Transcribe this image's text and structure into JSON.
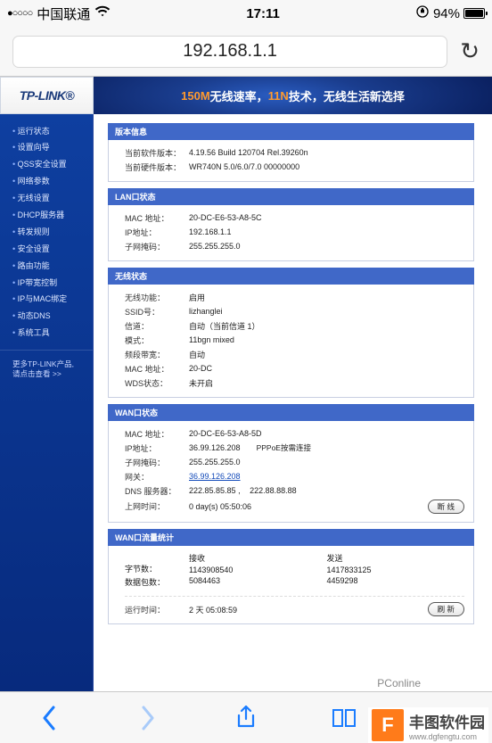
{
  "status": {
    "signal": "●○○○○",
    "carrier": "中国联通",
    "time": "17:11",
    "lock": "⟳",
    "battery": "94%"
  },
  "addr": "192.168.1.1",
  "logo": "TP-LINK",
  "banner": {
    "t1": "150M",
    "t2": "无线速率，",
    "t3": "11N",
    "t4": "技术，无线生活新选择"
  },
  "nav": [
    "运行状态",
    "设置向导",
    "QSS安全设置",
    "网络参数",
    "无线设置",
    "DHCP服务器",
    "转发规则",
    "安全设置",
    "路由功能",
    "IP带宽控制",
    "IP与MAC绑定",
    "动态DNS",
    "系统工具"
  ],
  "nav_more1": "更多TP-LINK产品,",
  "nav_more2": "请点击查看 >>",
  "sec_version": {
    "title": "版本信息",
    "rows": [
      {
        "lbl": "当前软件版本：",
        "val": "4.19.56 Build 120704 Rel.39260n"
      },
      {
        "lbl": "当前硬件版本：",
        "val": "WR740N 5.0/6.0/7.0 00000000"
      }
    ]
  },
  "sec_lan": {
    "title": "LAN口状态",
    "rows": [
      {
        "lbl": "MAC 地址：",
        "val": "20-DC-E6-53-A8-5C"
      },
      {
        "lbl": "IP地址：",
        "val": "192.168.1.1"
      },
      {
        "lbl": "子网掩码：",
        "val": "255.255.255.0"
      }
    ]
  },
  "sec_wlan": {
    "title": "无线状态",
    "rows": [
      {
        "lbl": "无线功能：",
        "val": "启用"
      },
      {
        "lbl": "SSID号：",
        "val": "lizhanglei"
      },
      {
        "lbl": "信道：",
        "val": "自动（当前信道 1）"
      },
      {
        "lbl": "模式：",
        "val": "11bgn mixed"
      },
      {
        "lbl": "频段带宽：",
        "val": "自动"
      },
      {
        "lbl": "MAC 地址：",
        "val": "20-DC"
      },
      {
        "lbl": "WDS状态：",
        "val": "未开启"
      }
    ]
  },
  "sec_wan": {
    "title": "WAN口状态",
    "mac": {
      "lbl": "MAC 地址：",
      "val": "20-DC-E6-53-A8-5D"
    },
    "ip": {
      "lbl": "IP地址：",
      "val": "36.99.126.208",
      "extra": "PPPoE按需连接"
    },
    "mask": {
      "lbl": "子网掩码：",
      "val": "255.255.255.0"
    },
    "gw": {
      "lbl": "网关：",
      "val": "36.99.126.208"
    },
    "dns": {
      "lbl": "DNS 服务器：",
      "v1": "222.85.85.85",
      "sep": " , ",
      "v2": "222.88.88.88"
    },
    "uptime": {
      "lbl": "上网时间：",
      "val": "0 day(s) 05:50:06",
      "btn": "断 线"
    }
  },
  "sec_traffic": {
    "title": "WAN口流量统计",
    "cols": [
      "",
      "接收",
      "发送"
    ],
    "bytes": {
      "lbl": "字节数：",
      "rx": "1143908540",
      "tx": "1417833125"
    },
    "pkts": {
      "lbl": "数据包数：",
      "rx": "5084463",
      "tx": "4459298"
    }
  },
  "runtime": {
    "lbl": "运行时间：",
    "val": "2 天 05:08:59",
    "btn": "刷 新"
  },
  "wm1": "PConline",
  "wm2": {
    "logo": "F",
    "text": "丰图软件园"
  }
}
